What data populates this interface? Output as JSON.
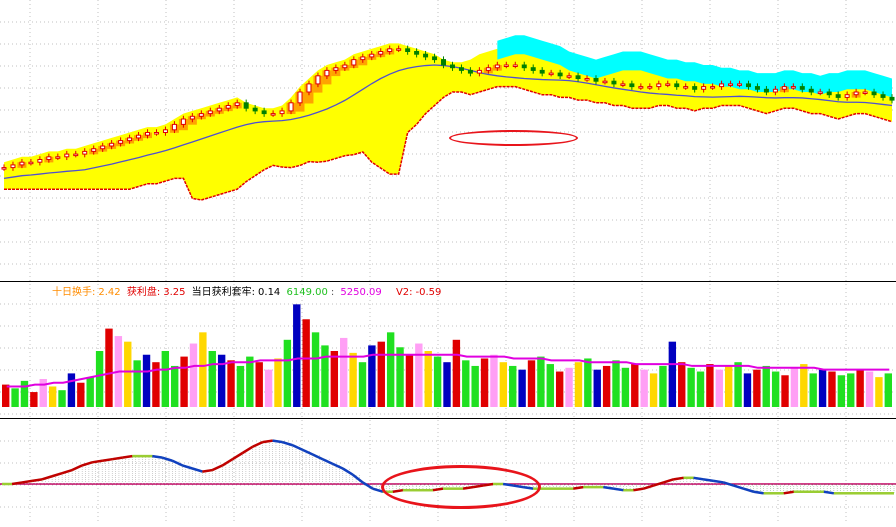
{
  "colors": {
    "cloud_yellow": "#ffff00",
    "cloud_cyan": "#00ffff",
    "cloud_edge": "#e00000",
    "candle_up": "#e00000",
    "candle_down": "#008000",
    "band_orange": "#ff8c00",
    "band_light": "#ffd070",
    "ma_line": "#5050d0",
    "vol_red": "#e00000",
    "vol_green": "#20e020",
    "vol_blue": "#0000c0",
    "vol_yellow": "#ffd700",
    "vol_pink": "#ff9ff5",
    "vol_ma": "#e000e0",
    "macd_line": "#9acd32",
    "macd_red": "#c00000",
    "macd_blue": "#1040c0",
    "grid": "#c0c0c0",
    "highlight_ellipse": "#e8141b"
  },
  "legend": {
    "item1_label": "十日换手:",
    "item1_value": "2.42",
    "item2_label": "获利盘:",
    "item2_value": "3.25",
    "item3_label": "当日获利套牢:",
    "item3_value": "0.14",
    "item4_value": "6149.00",
    "item5_value": "5250.09",
    "item6_label": "V2:",
    "item6_value": "-0.59",
    "item1_color": "#ff8c00",
    "item2_color": "#e00000",
    "item3_color": "#000000",
    "item4_color": "#20c020",
    "item5_color": "#e000e0",
    "item6_color": "#e00000"
  },
  "chart_data": [
    {
      "type": "candlestick",
      "panel": "price",
      "title": "",
      "ylim": [
        0,
        100
      ],
      "close": [
        42,
        43,
        44,
        44,
        45,
        46,
        46,
        47,
        47,
        48,
        49,
        50,
        51,
        52,
        53,
        54,
        55,
        55,
        56,
        58,
        60,
        61,
        62,
        63,
        64,
        65,
        66,
        64,
        63,
        62,
        62,
        63,
        66,
        70,
        73,
        76,
        78,
        79,
        80,
        82,
        83,
        84,
        85,
        86,
        86,
        85,
        84,
        83,
        82,
        80,
        79,
        78,
        77,
        78,
        79,
        80,
        80,
        80,
        79,
        78,
        77,
        77,
        76,
        76,
        75,
        75,
        74,
        74,
        73,
        73,
        72,
        72,
        72,
        73,
        73,
        72,
        72,
        71,
        72,
        72,
        73,
        73,
        73,
        72,
        71,
        70,
        71,
        72,
        72,
        71,
        70,
        70,
        69,
        68,
        69,
        70,
        70,
        69,
        68,
        67
      ]
    },
    {
      "type": "bar",
      "panel": "volume",
      "values": [
        12,
        10,
        14,
        8,
        15,
        11,
        9,
        18,
        13,
        16,
        30,
        42,
        38,
        35,
        25,
        28,
        24,
        30,
        22,
        27,
        34,
        40,
        30,
        28,
        25,
        22,
        27,
        24,
        20,
        26,
        36,
        55,
        47,
        40,
        33,
        30,
        37,
        29,
        24,
        33,
        35,
        40,
        32,
        28,
        34,
        30,
        27,
        24,
        36,
        25,
        22,
        26,
        28,
        24,
        22,
        20,
        25,
        27,
        23,
        19,
        21,
        24,
        26,
        20,
        22,
        25,
        21,
        23,
        20,
        18,
        22,
        35,
        24,
        21,
        19,
        23,
        20,
        22,
        24,
        18,
        20,
        22,
        19,
        17,
        21,
        23,
        18,
        20,
        19,
        17,
        18,
        20,
        19,
        16,
        18
      ],
      "ma": [
        11,
        11,
        11,
        12,
        12,
        13,
        13,
        14,
        15,
        16,
        17,
        18,
        19,
        19,
        19,
        19,
        20,
        20,
        21,
        21,
        22,
        22,
        23,
        23,
        24,
        24,
        24,
        25,
        25,
        25,
        25,
        26,
        26,
        26,
        27,
        27,
        27,
        27,
        27,
        28,
        28,
        28,
        28,
        28,
        28,
        28,
        28,
        28,
        28,
        27,
        27,
        27,
        27,
        27,
        26,
        26,
        26,
        26,
        25,
        25,
        25,
        25,
        24,
        24,
        24,
        24,
        24,
        23,
        23,
        23,
        23,
        23,
        23,
        22,
        22,
        22,
        22,
        22,
        22,
        22,
        21,
        21,
        21,
        21,
        21,
        21,
        21,
        20,
        20,
        20,
        20,
        20,
        20,
        20,
        20
      ]
    },
    {
      "type": "line",
      "panel": "macd",
      "values": [
        0,
        0,
        1,
        2,
        3,
        5,
        7,
        9,
        12,
        14,
        15,
        16,
        17,
        18,
        18,
        18,
        17,
        15,
        12,
        10,
        8,
        9,
        12,
        16,
        20,
        24,
        27,
        28,
        27,
        25,
        22,
        19,
        16,
        13,
        10,
        6,
        1,
        -3,
        -5,
        -5,
        -4,
        -4,
        -4,
        -4,
        -3,
        -3,
        -3,
        -2,
        -1,
        0,
        0,
        -1,
        -2,
        -3,
        -3,
        -3,
        -3,
        -3,
        -2,
        -2,
        -2,
        -3,
        -4,
        -4,
        -3,
        -1,
        1,
        3,
        4,
        4,
        3,
        2,
        1,
        -1,
        -3,
        -5,
        -6,
        -6,
        -6,
        -5,
        -5,
        -5,
        -5,
        -6,
        -6,
        -6,
        -6,
        -6,
        -6,
        -6
      ]
    }
  ]
}
